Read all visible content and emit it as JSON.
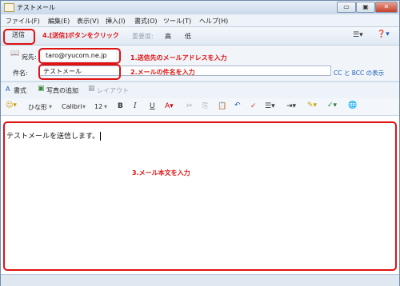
{
  "window": {
    "title": "テストメール",
    "controls": {
      "minimize": "▭",
      "maximize": "▣",
      "close": "✕"
    }
  },
  "menu": {
    "items": [
      "ファイル(F)",
      "編集(E)",
      "表示(V)",
      "挿入(I)",
      "書式(O)",
      "ツール(T)",
      "ヘルプ(H)"
    ]
  },
  "toolbar": {
    "send_label": "送信",
    "priority_label": "重要度:",
    "priority_high": "高",
    "priority_low": "低",
    "view_icon": "list-view-icon",
    "help_icon": "help-icon"
  },
  "annotations": {
    "send": "4.[送信]ボタンをクリック",
    "to": "1.送信先のメールアドレスを入力",
    "subject": "2.メールの件名を入力",
    "body": "3.メール本文を入力"
  },
  "header": {
    "to_label": "宛先:",
    "to_value": "taro@ryucom.ne.jp",
    "subject_label": "件名:",
    "subject_value": "テストメール",
    "cc_bcc_link": "CC と BCC の表示"
  },
  "format_row1": {
    "format_label": "書式",
    "photo_label": "写真の追加",
    "layout_label": "レイアウト"
  },
  "format_row2": {
    "style_label": "ひな形",
    "font_name": "Calibri",
    "font_size": "12",
    "bold": "B",
    "italic": "I",
    "underline": "U"
  },
  "message": {
    "body_text": "テストメールを送信します。"
  },
  "colors": {
    "annotation_red": "#e01212",
    "link_blue": "#1e5fb5"
  }
}
